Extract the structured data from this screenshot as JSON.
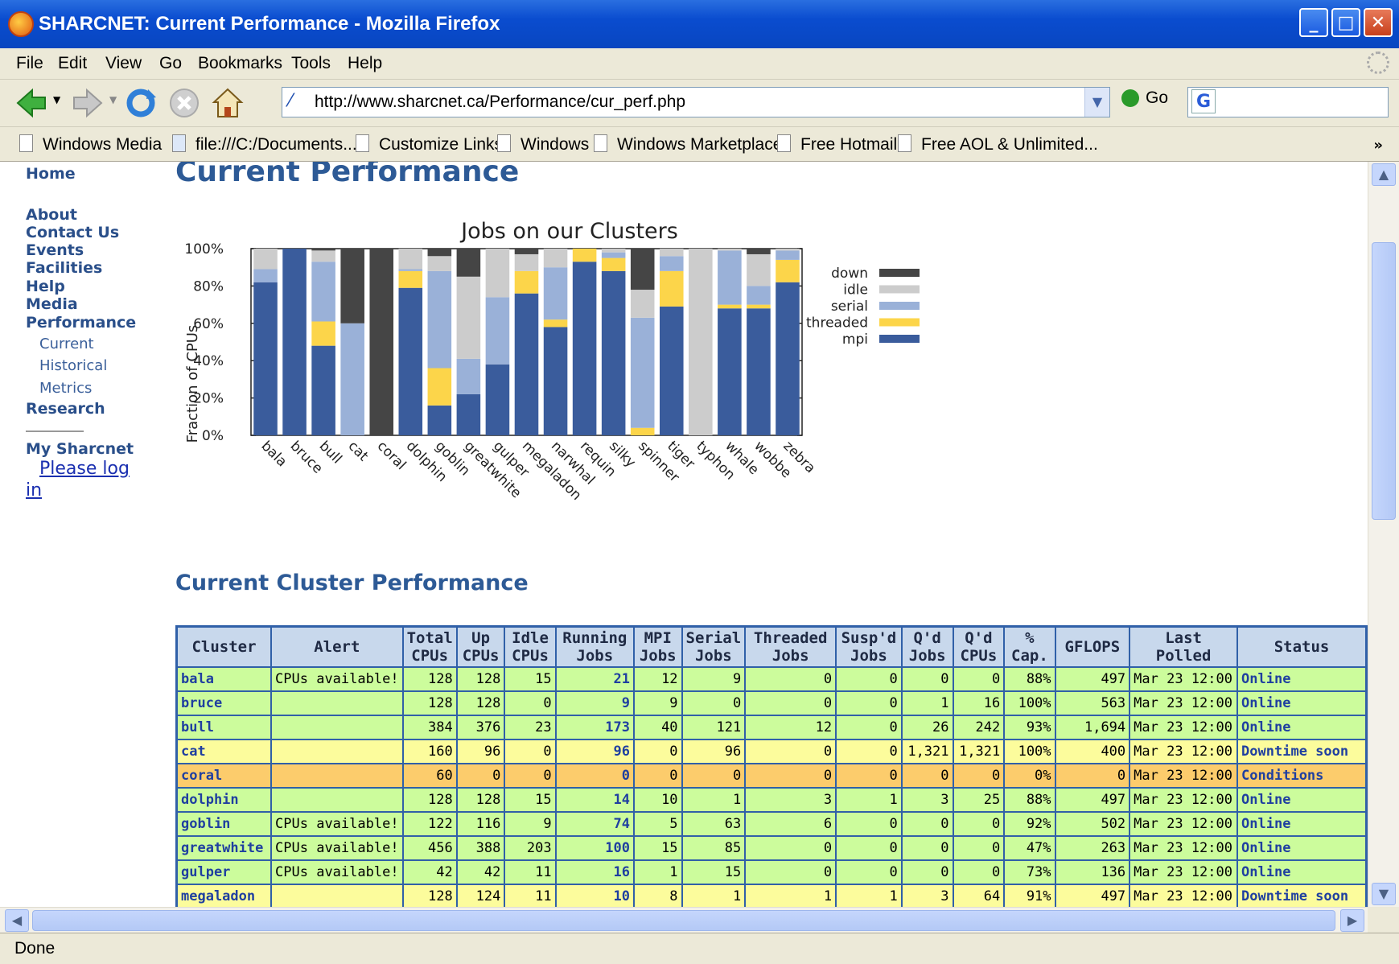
{
  "window": {
    "title": "SHARCNET: Current Performance - Mozilla Firefox"
  },
  "menu": [
    "File",
    "Edit",
    "View",
    "Go",
    "Bookmarks",
    "Tools",
    "Help"
  ],
  "toolbar": {
    "url": "http://www.sharcnet.ca/Performance/cur_perf.php",
    "go_label": "Go"
  },
  "bookmarks": [
    "Windows Media",
    "file:///C:/Documents...",
    "Customize Links",
    "Windows",
    "Windows Marketplace",
    "Free Hotmail",
    "Free AOL & Unlimited..."
  ],
  "status": "Done",
  "sidebar": {
    "home": "Home",
    "about": "About",
    "contact": "Contact Us",
    "events": "Events",
    "facilities": "Facilities",
    "help": "Help",
    "media": "Media",
    "performance": "Performance",
    "current": "Current",
    "historical": "Historical",
    "metrics": "Metrics",
    "research": "Research",
    "my_sharcnet": "My Sharcnet",
    "login1": "Please log",
    "login2": "in"
  },
  "page": {
    "title": "Current Performance",
    "section_title": "Current Cluster Performance"
  },
  "chart_data": {
    "type": "bar",
    "stacked": true,
    "title": "Jobs on our Clusters",
    "ylabel": "Fraction of CPUs",
    "xlabel": "",
    "ylim": [
      0,
      100
    ],
    "yticks": [
      "0%",
      "20%",
      "40%",
      "60%",
      "80%",
      "100%"
    ],
    "legend_position": "right",
    "categories": [
      "bala",
      "bruce",
      "bull",
      "cat",
      "coral",
      "dolphin",
      "goblin",
      "greatwhite",
      "gulper",
      "megaladon",
      "narwhal",
      "requin",
      "silky",
      "spinner",
      "tiger",
      "typhon",
      "whale",
      "wobbe",
      "zebra"
    ],
    "series": [
      {
        "name": "mpi",
        "color": "#3a5c9c",
        "values": [
          82,
          100,
          48,
          0,
          0,
          79,
          16,
          22,
          38,
          76,
          58,
          93,
          88,
          0,
          69,
          0,
          68,
          68,
          82
        ]
      },
      {
        "name": "threaded",
        "color": "#fcd54a",
        "values": [
          0,
          0,
          13,
          0,
          0,
          9,
          20,
          0,
          0,
          12,
          4,
          7,
          7,
          4,
          19,
          0,
          2,
          2,
          12
        ]
      },
      {
        "name": "serial",
        "color": "#9ab1d8",
        "values": [
          7,
          0,
          32,
          60,
          0,
          1,
          52,
          19,
          36,
          0,
          28,
          0,
          3,
          59,
          8,
          0,
          29,
          10,
          5
        ]
      },
      {
        "name": "idle",
        "color": "#cccccc",
        "values": [
          11,
          0,
          6,
          0,
          0,
          11,
          8,
          44,
          26,
          9,
          10,
          0,
          2,
          15,
          4,
          100,
          1,
          17,
          1
        ]
      },
      {
        "name": "down",
        "color": "#454545",
        "values": [
          0,
          0,
          1,
          40,
          100,
          0,
          4,
          15,
          0,
          3,
          0,
          0,
          0,
          22,
          0,
          0,
          0,
          3,
          0
        ]
      }
    ]
  },
  "table": {
    "headers": [
      [
        "Cluster"
      ],
      [
        "Alert"
      ],
      [
        "Total",
        "CPUs"
      ],
      [
        "Up",
        "CPUs"
      ],
      [
        "Idle",
        "CPUs"
      ],
      [
        "Running",
        "Jobs"
      ],
      [
        "MPI",
        "Jobs"
      ],
      [
        "Serial",
        "Jobs"
      ],
      [
        "Threaded",
        "Jobs"
      ],
      [
        "Susp'd",
        "Jobs"
      ],
      [
        "Q'd",
        "Jobs"
      ],
      [
        "Q'd",
        "CPUs"
      ],
      [
        "%",
        "Cap."
      ],
      [
        "GFLOPS"
      ],
      [
        "Last Polled"
      ],
      [
        "Status"
      ]
    ],
    "rows": [
      {
        "bg": "#ccfc9c",
        "cells": [
          "bala",
          "CPUs available!",
          "128",
          "128",
          "15",
          "21",
          "12",
          "9",
          "0",
          "0",
          "0",
          "0",
          "88%",
          "497",
          "Mar 23 12:00",
          "Online"
        ]
      },
      {
        "bg": "#ccfc9c",
        "cells": [
          "bruce",
          "",
          "128",
          "128",
          "0",
          "9",
          "9",
          "0",
          "0",
          "0",
          "1",
          "16",
          "100%",
          "563",
          "Mar 23 12:00",
          "Online"
        ]
      },
      {
        "bg": "#ccfc9c",
        "cells": [
          "bull",
          "",
          "384",
          "376",
          "23",
          "173",
          "40",
          "121",
          "12",
          "0",
          "26",
          "242",
          "93%",
          "1,694",
          "Mar 23 12:00",
          "Online"
        ]
      },
      {
        "bg": "#fcfc9c",
        "cells": [
          "cat",
          "",
          "160",
          "96",
          "0",
          "96",
          "0",
          "96",
          "0",
          "0",
          "1,321",
          "1,321",
          "100%",
          "400",
          "Mar 23 12:00",
          "Downtime soon"
        ]
      },
      {
        "bg": "#fccc6c",
        "cells": [
          "coral",
          "",
          "60",
          "0",
          "0",
          "0",
          "0",
          "0",
          "0",
          "0",
          "0",
          "0",
          "0%",
          "0",
          "Mar 23 12:00",
          "Conditions"
        ]
      },
      {
        "bg": "#ccfc9c",
        "cells": [
          "dolphin",
          "",
          "128",
          "128",
          "15",
          "14",
          "10",
          "1",
          "3",
          "1",
          "3",
          "25",
          "88%",
          "497",
          "Mar 23 12:00",
          "Online"
        ]
      },
      {
        "bg": "#ccfc9c",
        "cells": [
          "goblin",
          "CPUs available!",
          "122",
          "116",
          "9",
          "74",
          "5",
          "63",
          "6",
          "0",
          "0",
          "0",
          "92%",
          "502",
          "Mar 23 12:00",
          "Online"
        ]
      },
      {
        "bg": "#ccfc9c",
        "cells": [
          "greatwhite",
          "CPUs available!",
          "456",
          "388",
          "203",
          "100",
          "15",
          "85",
          "0",
          "0",
          "0",
          "0",
          "47%",
          "263",
          "Mar 23 12:00",
          "Online"
        ]
      },
      {
        "bg": "#ccfc9c",
        "cells": [
          "gulper",
          "CPUs available!",
          "42",
          "42",
          "11",
          "16",
          "1",
          "15",
          "0",
          "0",
          "0",
          "0",
          "73%",
          "136",
          "Mar 23 12:00",
          "Online"
        ]
      },
      {
        "bg": "#fcfc9c",
        "cells": [
          "megaladon",
          "",
          "128",
          "124",
          "11",
          "10",
          "8",
          "1",
          "1",
          "1",
          "3",
          "64",
          "91%",
          "497",
          "Mar 23 12:00",
          "Downtime soon"
        ]
      }
    ]
  }
}
